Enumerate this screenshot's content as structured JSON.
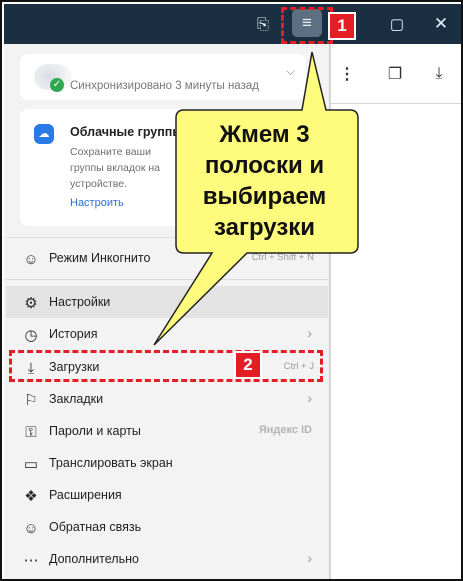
{
  "titlebar": {
    "bookmarks_icon": "bookmark-pages-icon",
    "menu_icon": "hamburger-icon",
    "maximize_icon": "maximize-icon",
    "close_icon": "close-icon"
  },
  "toolbar": {
    "more_icon": "more-vertical-icon",
    "collections_icon": "collections-icon",
    "download_icon": "download-icon"
  },
  "sync": {
    "status": "Синхронизировано 3 минуты назад"
  },
  "cloud": {
    "title": "Облачные группы",
    "description": "Сохраните ваши группы вкладок на устройстве.",
    "description_l1": "Сохраните ваши",
    "description_l2": "группы вкладок на",
    "description_l3": "устройстве.",
    "link": "Настроить"
  },
  "menu": {
    "incognito": {
      "label": "Режим Инкогнито",
      "shortcut": "Ctrl + Shift + N"
    },
    "settings": {
      "label": "Настройки"
    },
    "history": {
      "label": "История"
    },
    "downloads": {
      "label": "Загрузки",
      "shortcut": "Ctrl + J"
    },
    "bookmarks": {
      "label": "Закладки"
    },
    "passwords": {
      "label": "Пароли и карты",
      "badge": "Яндекс ID"
    },
    "cast": {
      "label": "Транслировать экран"
    },
    "extensions": {
      "label": "Расширения"
    },
    "feedback": {
      "label": "Обратная связь"
    },
    "more": {
      "label": "Дополнительно"
    }
  },
  "annotations": {
    "step1": "1",
    "step2": "2",
    "callout_l1": "Жмем 3",
    "callout_l2": "полоски и",
    "callout_l3": "выбираем",
    "callout_l4": "загрузки",
    "callout_fill": "#fffb7d",
    "accent": "#e31e24"
  }
}
